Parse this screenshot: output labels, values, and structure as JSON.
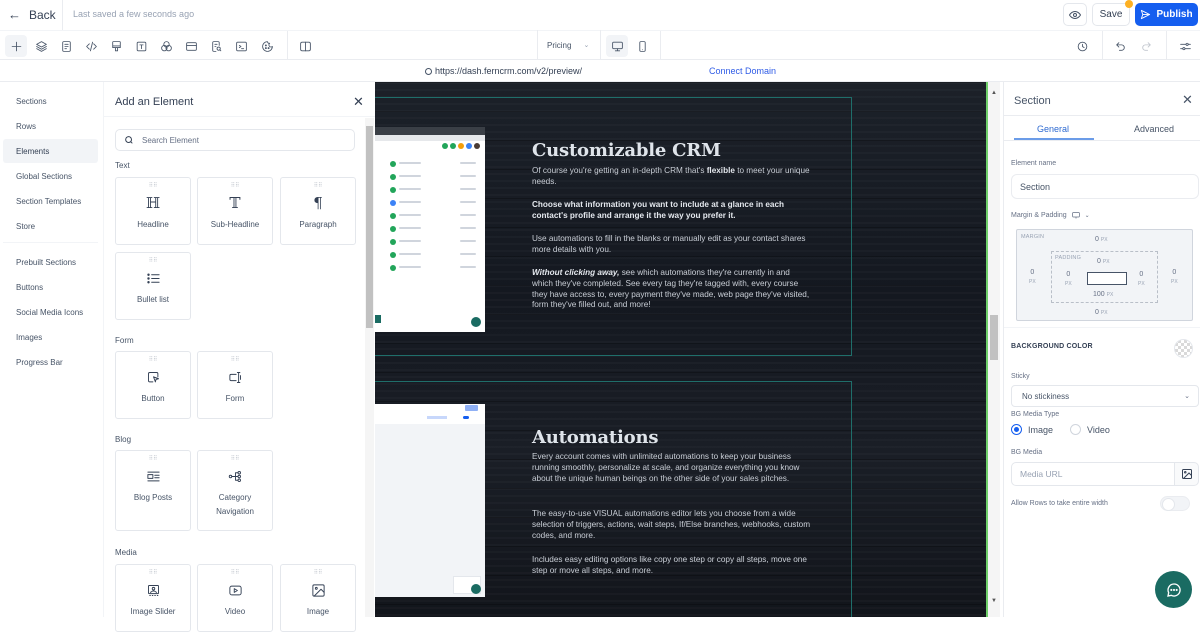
{
  "topbar": {
    "back_label": "Back",
    "last_saved": "Last saved a few seconds ago",
    "save_label": "Save",
    "publish_label": "Publish",
    "publish_color": "#155eef",
    "unsaved_dot_color": "#fdb022"
  },
  "toolbar": {
    "tools": [
      {
        "icon": "plus-icon",
        "name": "add-element"
      },
      {
        "icon": "layers-icon",
        "name": "layers"
      },
      {
        "icon": "page-icon",
        "name": "pages"
      },
      {
        "icon": "code-icon",
        "name": "custom-code"
      },
      {
        "icon": "paint-brush-icon",
        "name": "styles"
      },
      {
        "icon": "text-icon",
        "name": "typography"
      },
      {
        "icon": "colors-icon",
        "name": "colors"
      },
      {
        "icon": "section-icon",
        "name": "sections"
      },
      {
        "icon": "page-search-icon",
        "name": "seo"
      },
      {
        "icon": "terminal-icon",
        "name": "tracking-code"
      },
      {
        "icon": "cookie-icon",
        "name": "cookie-consent"
      },
      {
        "icon": "split-view-icon",
        "name": "split-view"
      }
    ],
    "page_select": "Pricing",
    "devices": [
      "desktop",
      "mobile"
    ],
    "history_icon": "history-icon",
    "undo_icon": "undo-icon",
    "redo_icon": "redo-icon",
    "settings_icon": "settings-sliders-icon"
  },
  "urlbar": {
    "url": "https://dash.ferncrm.com/v2/preview/",
    "connect_domain": "Connect Domain"
  },
  "left_nav": {
    "items": [
      {
        "label": "Sections"
      },
      {
        "label": "Rows"
      },
      {
        "label": "Elements",
        "active": true
      },
      {
        "label": "Global Sections"
      },
      {
        "label": "Section Templates"
      },
      {
        "label": "Store"
      }
    ],
    "items2": [
      {
        "label": "Prebuilt Sections"
      },
      {
        "label": "Buttons"
      },
      {
        "label": "Social Media Icons"
      },
      {
        "label": "Images"
      },
      {
        "label": "Progress Bar"
      }
    ]
  },
  "elements_panel": {
    "title": "Add an Element",
    "search_placeholder": "Search Element",
    "groups": [
      {
        "label": "Text",
        "items": [
          "Headline",
          "Sub-Headline",
          "Paragraph",
          "Bullet list"
        ]
      },
      {
        "label": "Form",
        "items": [
          "Button",
          "Form"
        ]
      },
      {
        "label": "Blog",
        "items": [
          "Blog Posts",
          "Category Navigation"
        ]
      },
      {
        "label": "Media",
        "items": [
          "Image Slider",
          "Video",
          "Image"
        ]
      }
    ]
  },
  "canvas": {
    "section1": {
      "title": "Customizable CRM",
      "p1_pre": "Of course you're getting an in-depth CRM that's ",
      "p1_bold": "flexible",
      "p1_post": " to meet your unique needs.",
      "p2": "Choose what information you want to include at a glance in each contact's profile and arrange it the way you prefer it.",
      "p3": "Use automations to fill in the blanks or manually edit as your contact shares more details with you.",
      "p4_bold": "Without clicking away,",
      "p4_post": " see which automations they're currently in and which they've completed. See every tag they're tagged with, every course they have access to, every payment they've made, web page they've visited, form they've filled out, and more!"
    },
    "section2": {
      "title": "Automations",
      "p1": "Every account comes with unlimited automations to keep your business running smoothly, personalize at scale, and organize everything you know about the unique human beings on the other side of your sales pitches.",
      "p2": "The easy-to-use VISUAL automations editor lets you choose from a wide selection of triggers, actions, wait steps, If/Else branches, webhooks, custom codes, and more.",
      "p3": "Includes easy editing options like copy one step or copy all steps, move one step or move all steps, and more."
    }
  },
  "right_panel": {
    "title": "Section",
    "tabs": [
      {
        "label": "General",
        "active": true
      },
      {
        "label": "Advanced"
      }
    ],
    "element_name_label": "Element name",
    "element_name_value": "Section",
    "margin_padding_label": "Margin & Padding",
    "margin_tag": "MARGIN",
    "padding_tag": "PADDING",
    "margin": {
      "top": "0",
      "right": "0",
      "bottom": "0",
      "left": "0"
    },
    "padding": {
      "top": "0",
      "right": "0",
      "bottom": "100",
      "left": "0"
    },
    "unit": "PX",
    "bg_color_label": "BACKGROUND COLOR",
    "sticky_label": "Sticky",
    "sticky_value": "No stickiness",
    "bg_media_type_label": "BG Media Type",
    "media_types": [
      {
        "label": "Image",
        "selected": true
      },
      {
        "label": "Video",
        "selected": false
      }
    ],
    "bg_media_label": "BG Media",
    "media_url_placeholder": "Media URL",
    "allow_rows_label": "Allow Rows to take entire width",
    "allow_rows_enabled": false
  },
  "chat_fab_color": "#1a6b62"
}
